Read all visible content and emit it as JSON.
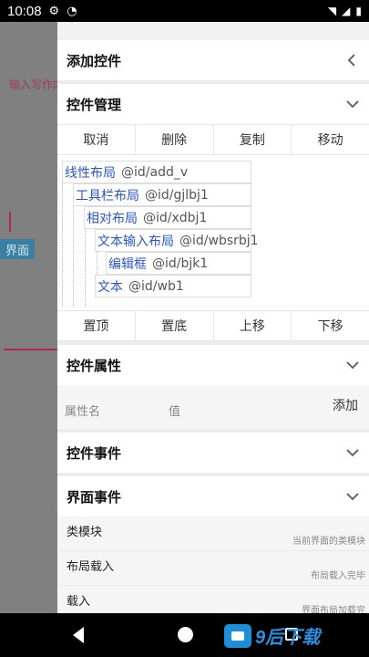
{
  "status": {
    "time": "10:08"
  },
  "background": {
    "hint": "输入写作内",
    "tag": "界面"
  },
  "drawer": {
    "add_widget": "添加控件",
    "widget_manage": "控件管理",
    "top_buttons": [
      "取消",
      "删除",
      "复制",
      "移动"
    ],
    "tree": [
      {
        "name": "线性布局",
        "id": "@id/add_v"
      },
      {
        "name": "工具栏布局",
        "id": "@id/gjlbj1"
      },
      {
        "name": "相对布局",
        "id": "@id/xdbj1"
      },
      {
        "name": "文本输入布局",
        "id": "@id/wbsrbj1"
      },
      {
        "name": "编辑框",
        "id": "@id/bjk1"
      },
      {
        "name": "文本",
        "id": "@id/wb1"
      }
    ],
    "bottom_buttons": [
      "置顶",
      "置底",
      "上移",
      "下移"
    ],
    "widget_props": "控件属性",
    "attr": {
      "key_label": "属性名",
      "value_label": "值",
      "add": "添加"
    },
    "widget_events": "控件事件",
    "ui_events": "界面事件",
    "events": [
      {
        "title": "类模块",
        "desc": "当前界面的类模块"
      },
      {
        "title": "布局载入",
        "desc": "布局载入完毕"
      },
      {
        "title": "载入",
        "desc": "界面布局加载完"
      }
    ]
  },
  "watermark": {
    "text": "9后下载"
  }
}
